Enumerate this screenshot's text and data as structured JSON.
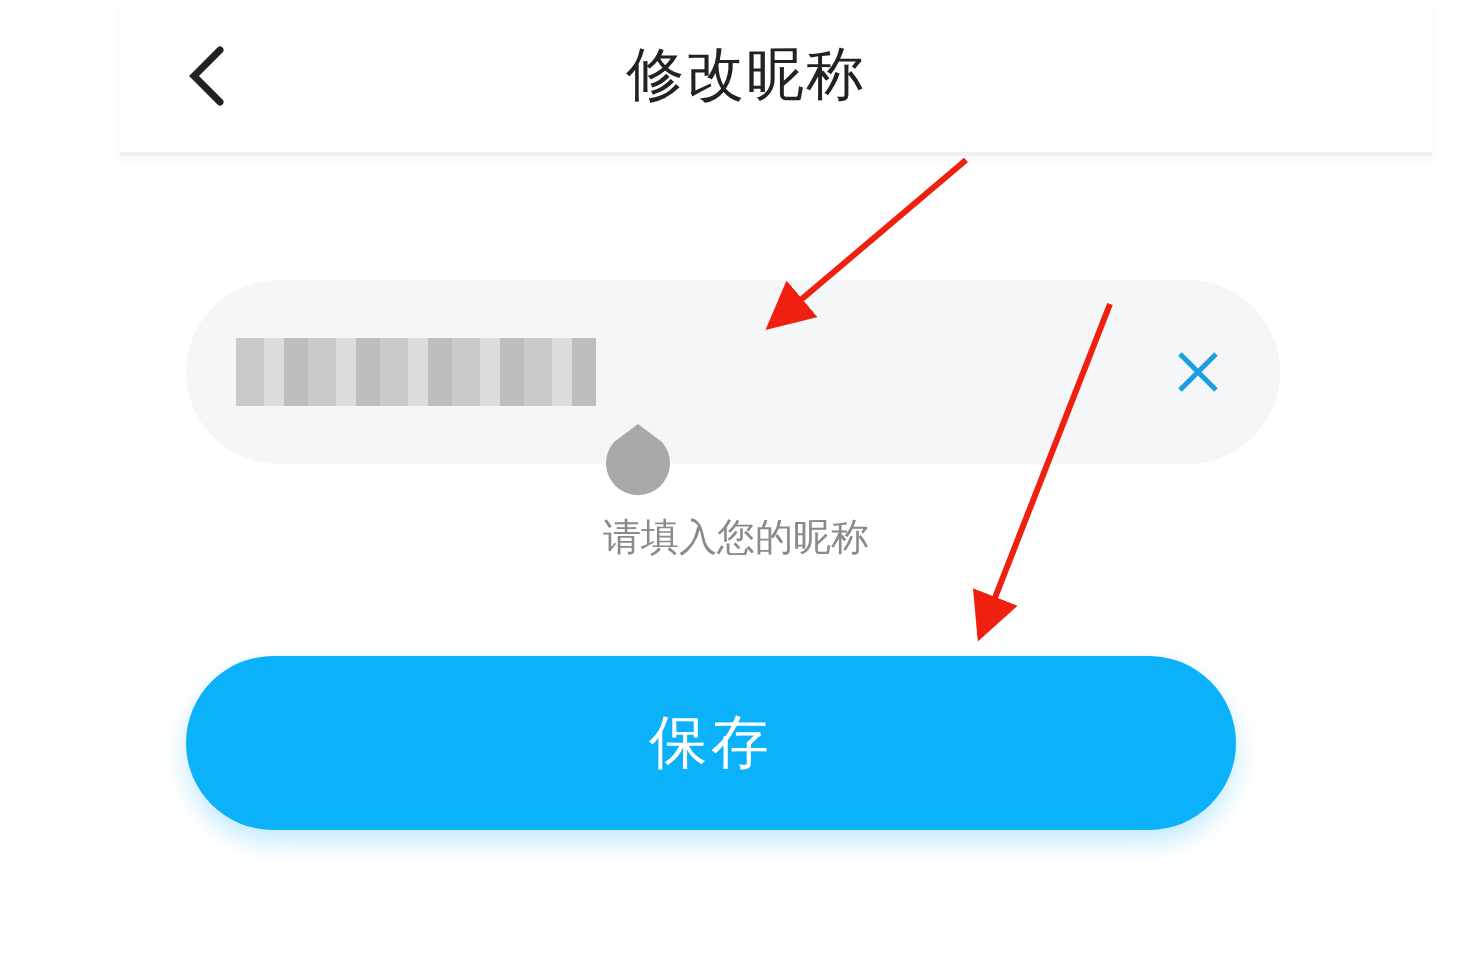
{
  "header": {
    "title": "修改昵称"
  },
  "nickname_field": {
    "hint": "请填入您的昵称"
  },
  "save_button": {
    "label": "保存"
  }
}
